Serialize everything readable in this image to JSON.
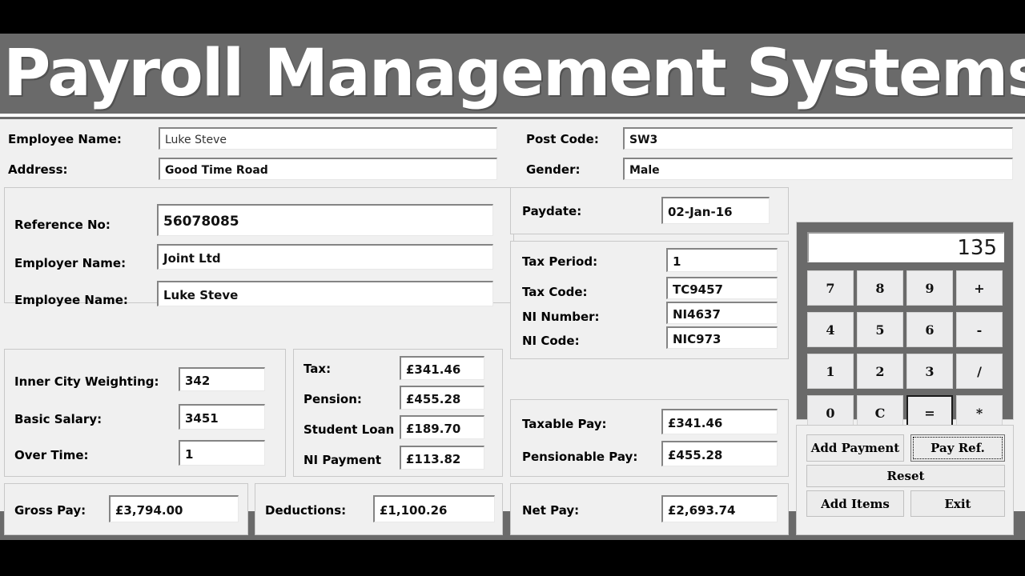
{
  "window": {
    "title": "Payroll Management Systems"
  },
  "top_fields": {
    "employee_name_label": "Employee Name:",
    "employee_name_value": "Luke Steve",
    "address_label": "Address:",
    "address_value": "Good Time Road",
    "post_code_label": "Post Code:",
    "post_code_value": "SW3",
    "gender_label": "Gender:",
    "gender_value": "Male"
  },
  "reference_panel": {
    "reference_no_label": "Reference No:",
    "reference_no_value": "56078085",
    "employer_name_label": "Employer Name:",
    "employer_name_value": "Joint Ltd",
    "employee_name_label": "Employee Name:",
    "employee_name_value": "Luke Steve"
  },
  "earnings_panel": {
    "inner_city_weighting_label": "Inner City Weighting:",
    "inner_city_weighting_value": "342",
    "basic_salary_label": "Basic Salary:",
    "basic_salary_value": "3451",
    "over_time_label": "Over Time:",
    "over_time_value": "1"
  },
  "deductions_panel": {
    "tax_label": "Tax:",
    "tax_value": "£341.46",
    "pension_label": "Pension:",
    "pension_value": "£455.28",
    "student_loan_label": "Student Loan",
    "student_loan_value": "£189.70",
    "ni_payment_label": "NI Payment",
    "ni_payment_value": "£113.82"
  },
  "paydate_panel": {
    "paydate_label": "Paydate:",
    "paydate_value": "02-Jan-16"
  },
  "tax_panel": {
    "tax_period_label": "Tax Period:",
    "tax_period_value": "1",
    "tax_code_label": "Tax Code:",
    "tax_code_value": "TC9457",
    "ni_number_label": "NI Number:",
    "ni_number_value": "NI4637",
    "ni_code_label": "NI Code:",
    "ni_code_value": "NIC973"
  },
  "pay_panel": {
    "taxable_pay_label": "Taxable Pay:",
    "taxable_pay_value": "£341.46",
    "pensionable_pay_label": "Pensionable Pay:",
    "pensionable_pay_value": "£455.28"
  },
  "totals": {
    "gross_pay_label": "Gross Pay:",
    "gross_pay_value": "£3,794.00",
    "deductions_label": "Deductions:",
    "deductions_value": "£1,100.26",
    "net_pay_label": "Net Pay:",
    "net_pay_value": "£2,693.74"
  },
  "calculator": {
    "display_value": "135",
    "keys": [
      {
        "label": "7",
        "name": "calc-key-7",
        "focused": false
      },
      {
        "label": "8",
        "name": "calc-key-8",
        "focused": false
      },
      {
        "label": "9",
        "name": "calc-key-9",
        "focused": false
      },
      {
        "label": "+",
        "name": "calc-key-plus",
        "focused": false
      },
      {
        "label": "4",
        "name": "calc-key-4",
        "focused": false
      },
      {
        "label": "5",
        "name": "calc-key-5",
        "focused": false
      },
      {
        "label": "6",
        "name": "calc-key-6",
        "focused": false
      },
      {
        "label": "-",
        "name": "calc-key-minus",
        "focused": false
      },
      {
        "label": "1",
        "name": "calc-key-1",
        "focused": false
      },
      {
        "label": "2",
        "name": "calc-key-2",
        "focused": false
      },
      {
        "label": "3",
        "name": "calc-key-3",
        "focused": false
      },
      {
        "label": "/",
        "name": "calc-key-divide",
        "focused": false
      },
      {
        "label": "0",
        "name": "calc-key-0",
        "focused": false
      },
      {
        "label": "C",
        "name": "calc-key-clear",
        "focused": false
      },
      {
        "label": "=",
        "name": "calc-key-equals",
        "focused": true
      },
      {
        "label": "*",
        "name": "calc-key-multiply",
        "focused": false
      }
    ]
  },
  "actions": {
    "add_payment": "Add Payment",
    "pay_ref": "Pay Ref.",
    "reset": "Reset",
    "add_items": "Add Items",
    "exit": "Exit"
  },
  "colors": {
    "header_bg": "#6a6a6a",
    "client_bg": "#f0f0f0",
    "calc_frame": "#6a6a6a",
    "title_text": "#ffffff",
    "letterbox": "#000000"
  }
}
